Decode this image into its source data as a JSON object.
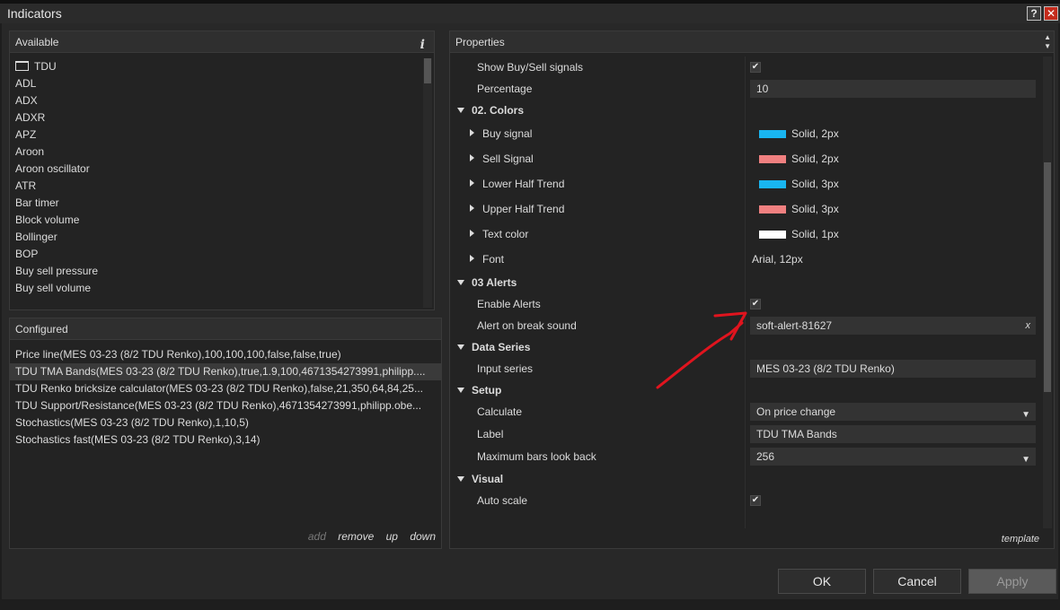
{
  "window": {
    "title": "Indicators",
    "help_label": "?",
    "close_label": "✕"
  },
  "available": {
    "header": "Available",
    "info_label": "i",
    "items": [
      "TDU",
      "ADL",
      "ADX",
      "ADXR",
      "APZ",
      "Aroon",
      "Aroon oscillator",
      "ATR",
      "Bar timer",
      "Block volume",
      "Bollinger",
      "BOP",
      "Buy sell pressure",
      "Buy sell volume"
    ]
  },
  "configured": {
    "header": "Configured",
    "items": [
      "Price line(MES 03-23 (8/2 TDU Renko),100,100,100,false,false,true)",
      "TDU TMA Bands(MES 03-23 (8/2 TDU Renko),true,1.9,100,4671354273991,philipp....",
      "TDU Renko bricksize calculator(MES 03-23 (8/2 TDU Renko),false,21,350,64,84,25...",
      "TDU Support/Resistance(MES 03-23 (8/2 TDU Renko),4671354273991,philipp.obe...",
      "Stochastics(MES 03-23 (8/2 TDU Renko),1,10,5)",
      "Stochastics fast(MES 03-23 (8/2 TDU Renko),3,14)"
    ],
    "selected_index": 1,
    "actions": {
      "add": "add",
      "remove": "remove",
      "up": "up",
      "down": "down"
    }
  },
  "properties": {
    "header": "Properties",
    "show_signals": {
      "label": "Show Buy/Sell signals",
      "checked": true
    },
    "percentage": {
      "label": "Percentage",
      "value": "10"
    },
    "colors": {
      "title": "02. Colors",
      "buy_signal": {
        "label": "Buy signal",
        "value": "Solid, 2px",
        "color": "#19b5f0"
      },
      "sell_signal": {
        "label": "Sell Signal",
        "value": "Solid, 2px",
        "color": "#f08080"
      },
      "lower_half_trend": {
        "label": "Lower Half Trend",
        "value": "Solid, 3px",
        "color": "#19b5f0"
      },
      "upper_half_trend": {
        "label": "Upper Half Trend",
        "value": "Solid, 3px",
        "color": "#f08080"
      },
      "text_color": {
        "label": "Text color",
        "value": "Solid, 1px",
        "color": "#ffffff"
      },
      "font": {
        "label": "Font",
        "value": "Arial, 12px"
      }
    },
    "alerts": {
      "title": "03 Alerts",
      "enable": {
        "label": "Enable Alerts",
        "checked": true
      },
      "break_sound": {
        "label": "Alert on break sound",
        "value": "soft-alert-81627",
        "clear": "x"
      }
    },
    "data_series": {
      "title": "Data Series",
      "input_series": {
        "label": "Input series",
        "value": "MES 03-23 (8/2 TDU Renko)"
      }
    },
    "setup": {
      "title": "Setup",
      "calculate": {
        "label": "Calculate",
        "value": "On price change"
      },
      "label": {
        "label": "Label",
        "value": "TDU TMA Bands"
      },
      "max_bars": {
        "label": "Maximum bars look back",
        "value": "256"
      }
    },
    "visual": {
      "title": "Visual",
      "auto_scale": {
        "label": "Auto scale",
        "checked": true
      }
    },
    "template_link": "template"
  },
  "buttons": {
    "ok": "OK",
    "cancel": "Cancel",
    "apply": "Apply"
  },
  "colors": {
    "annotation_arrow": "#e0141e",
    "dialog_bg": "#282828"
  }
}
